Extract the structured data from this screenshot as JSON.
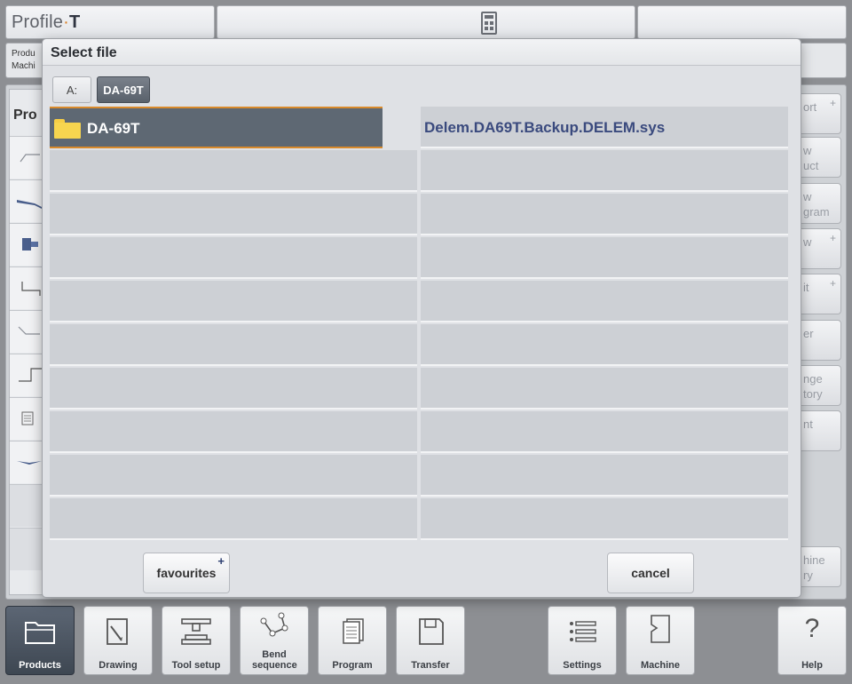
{
  "app": {
    "brand_main": "Profile",
    "brand_dot": "·",
    "brand_suffix": "T"
  },
  "background": {
    "header_line1": "Produ",
    "header_line2": "Machi",
    "list_title": "Pro",
    "side_buttons": [
      {
        "label": "ort",
        "plus": true
      },
      {
        "label": "w\nuct",
        "plus": false
      },
      {
        "label": "w\ngram",
        "plus": false
      },
      {
        "label": "w",
        "plus": true
      },
      {
        "label": "it",
        "plus": true
      },
      {
        "label": "er",
        "plus": false
      },
      {
        "label": "nge\ntory",
        "plus": false
      },
      {
        "label": "nt",
        "plus": false
      },
      {
        "label": "hine\nry",
        "plus": false
      }
    ]
  },
  "dialog": {
    "title": "Select file",
    "drives": [
      {
        "label": "A:",
        "active": false
      },
      {
        "label": "DA-69T",
        "active": true
      }
    ],
    "folders": [
      {
        "name": "DA-69T",
        "selected": true
      }
    ],
    "files": [
      {
        "name": "Delem.DA69T.Backup.DELEM.sys"
      }
    ],
    "favourites_label": "favourites",
    "favourites_plus": "+",
    "cancel_label": "cancel"
  },
  "navigation": [
    {
      "label": "Products",
      "icon": "folder-icon",
      "active": true
    },
    {
      "label": "Drawing",
      "icon": "drawing-icon",
      "active": false
    },
    {
      "label": "Tool setup",
      "icon": "tool-setup-icon",
      "active": false
    },
    {
      "label": "Bend sequence",
      "icon": "bend-sequence-icon",
      "active": false
    },
    {
      "label": "Program",
      "icon": "program-icon",
      "active": false
    },
    {
      "label": "Transfer",
      "icon": "transfer-icon",
      "active": false
    },
    {
      "label": "Settings",
      "icon": "settings-icon",
      "active": false
    },
    {
      "label": "Machine",
      "icon": "machine-icon",
      "active": false
    },
    {
      "label": "Help",
      "icon": "help-icon",
      "active": false
    }
  ],
  "colors": {
    "accent": "#d98a2b",
    "selected_row": "#5e6873",
    "file_text": "#3a4a7e",
    "folder": "#f7d54f"
  }
}
